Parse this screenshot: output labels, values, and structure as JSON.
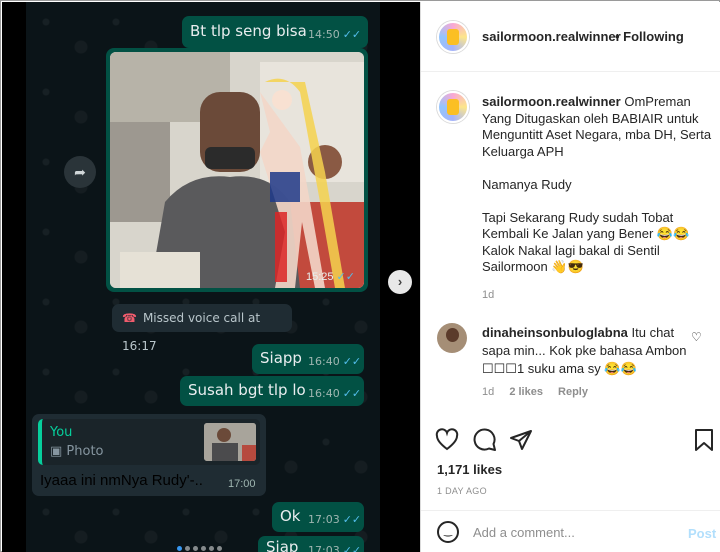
{
  "chat": {
    "messages": [
      {
        "text": "Bt tlp seng bisa",
        "time": "14:50",
        "ticks": "✓✓"
      },
      {
        "text": "Siapp",
        "time": "16:40",
        "ticks": "✓✓"
      },
      {
        "text": "Susah bgt tlp lo",
        "time": "16:40",
        "ticks": "✓✓"
      },
      {
        "text": "Ok",
        "time": "17:03",
        "ticks": "✓✓"
      },
      {
        "text": "Siap",
        "time": "17:03",
        "ticks": "✓✓"
      }
    ],
    "photo_time": "15:25",
    "photo_ticks": "✓✓",
    "missed_call": "Missed voice call at 16:17",
    "reply": {
      "quote_author": "You",
      "quote_type": "Photo",
      "text": "Iyaaa ini nmNya Rudy'-..",
      "time": "17:00"
    }
  },
  "post": {
    "username": "sailormoon.realwinner",
    "follow_status": "• Following",
    "caption": "OmPreman Yang Ditugaskan oleh BABIAIR untuk Menguntitt Aset Negara, mba DH, Serta Keluarga APH\n\nNamanya Rudy\n\nTapi Sekarang Rudy sudah Tobat Kembali Ke Jalan yang Bener 😂😂\nKalok Nakal lagi bakal di Sentil Sailormoon 👋😎",
    "caption_age": "1d",
    "likes": "1,171 likes",
    "posted": "1 DAY AGO"
  },
  "comment": {
    "username": "dinaheinsonbuloglabna",
    "text": "Itu chat sapa min... Kok pke bahasa Ambon ☐☐☐1 suku ama sy 😂😂",
    "age": "1d",
    "likes": "2 likes",
    "reply": "Reply"
  },
  "add_comment": {
    "placeholder": "Add a comment...",
    "post_label": "Post"
  },
  "icons": {
    "forward": "forward-icon",
    "next": "chevron-right-icon",
    "like": "heart-icon",
    "comment": "comment-icon",
    "share": "share-icon",
    "save": "bookmark-icon",
    "emoji": "emoji-icon"
  },
  "colors": {
    "chat_bg": "#0b1418",
    "outgoing_bubble": "#025144",
    "incoming_bubble": "#1f2c33",
    "read_ticks": "#53bdeb",
    "instagram_blue": "#3797f0"
  },
  "carousel": {
    "count": 6,
    "active": 1
  }
}
